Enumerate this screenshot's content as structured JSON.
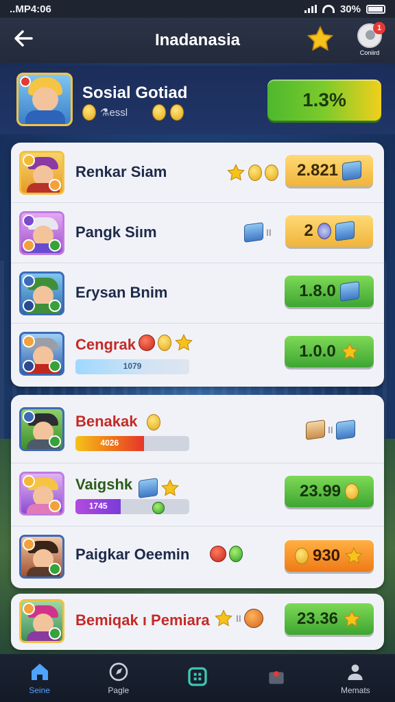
{
  "status": {
    "time": "..MP4:06",
    "battery": "30%"
  },
  "header": {
    "title": "Inadanasia",
    "profile_label": "Coniird",
    "notification_count": "1"
  },
  "hero": {
    "name": "Sosial Gotiad",
    "sub": "⚗essl",
    "value": "1.3%"
  },
  "card1": [
    {
      "name": "Renkar Siam",
      "value": "2.821",
      "icons": [
        "star",
        "coin",
        "coin"
      ],
      "value_icon": "box",
      "button": "gold"
    },
    {
      "name": "Pangk Siım",
      "value": "2",
      "icons": [
        "box",
        "sep"
      ],
      "value_icon": "box",
      "button": "gold"
    },
    {
      "name": "Eɾysan Bnim",
      "value": "1.8.0",
      "icons": [],
      "value_icon": "box",
      "button": "green"
    },
    {
      "name": "Cengrak",
      "value": "1.0.0",
      "progress_text": "1079",
      "progress": 0.0,
      "icons": [
        "coin-red",
        "coin",
        "star"
      ],
      "value_icon": "star",
      "button": "green"
    }
  ],
  "card2": [
    {
      "name": "Benakak",
      "progress_text": "4026",
      "progress": 0.6,
      "icons": [
        "coin"
      ],
      "right_icons": [
        "box-tan",
        "sep",
        "box"
      ]
    },
    {
      "name": "Vaigshk",
      "value": "23.99",
      "progress_text": "1745",
      "progress": 0.4,
      "icons": [
        "box",
        "star"
      ],
      "value_icon": "coin",
      "button": "green"
    },
    {
      "name": "Paigkar Oeemin",
      "value": "930",
      "icons": [
        "coin-red",
        "coin-green"
      ],
      "value_icon": "star",
      "button": "orange"
    }
  ],
  "card3": [
    {
      "name": "Bemiqak ı Pemiara",
      "value": "23.36",
      "icons": [
        "star",
        "sep",
        "coin-orange"
      ],
      "value_icon": "star",
      "button": "green"
    }
  ],
  "nav": [
    {
      "label": "Seine",
      "icon": "home-icon",
      "active": true
    },
    {
      "label": "Pagle",
      "icon": "compass-icon",
      "active": false
    },
    {
      "label": "",
      "icon": "grid-icon",
      "active": false
    },
    {
      "label": "",
      "icon": "chest-icon",
      "active": false
    },
    {
      "label": "Memats",
      "icon": "person-icon",
      "active": false
    }
  ],
  "colors": {
    "accent_blue": "#4fa3ff",
    "green": "#3ea532",
    "gold": "#f0b43a",
    "orange": "#ef7a18",
    "red_name": "#c42a26"
  }
}
